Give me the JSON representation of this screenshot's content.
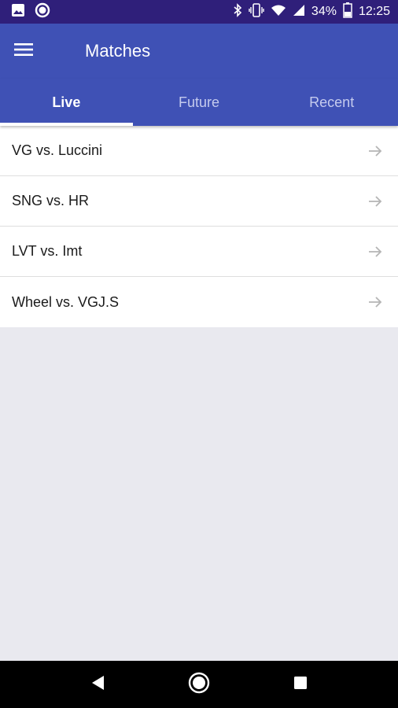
{
  "status_bar": {
    "battery": "34%",
    "time": "12:25",
    "icons": [
      "image-icon",
      "record-icon",
      "bluetooth-icon",
      "vibrate-icon",
      "wifi-icon",
      "signal-icon",
      "battery-icon"
    ]
  },
  "app_bar": {
    "title": "Matches",
    "menu_icon": "hamburger-menu-icon"
  },
  "tabs": [
    {
      "label": "Live",
      "active": true
    },
    {
      "label": "Future",
      "active": false
    },
    {
      "label": "Recent",
      "active": false
    }
  ],
  "matches": [
    {
      "label": "VG vs. Luccini"
    },
    {
      "label": "SNG vs. HR"
    },
    {
      "label": "LVT vs. Imt"
    },
    {
      "label": "Wheel vs. VGJ.S"
    }
  ],
  "nav_bar": {
    "icons": [
      "back-icon",
      "home-icon",
      "recents-icon"
    ]
  },
  "colors": {
    "status_bar": "#2f1f7a",
    "primary": "#3f51b5",
    "tab_inactive": "#c5cbee",
    "background": "#e9e9ef"
  }
}
